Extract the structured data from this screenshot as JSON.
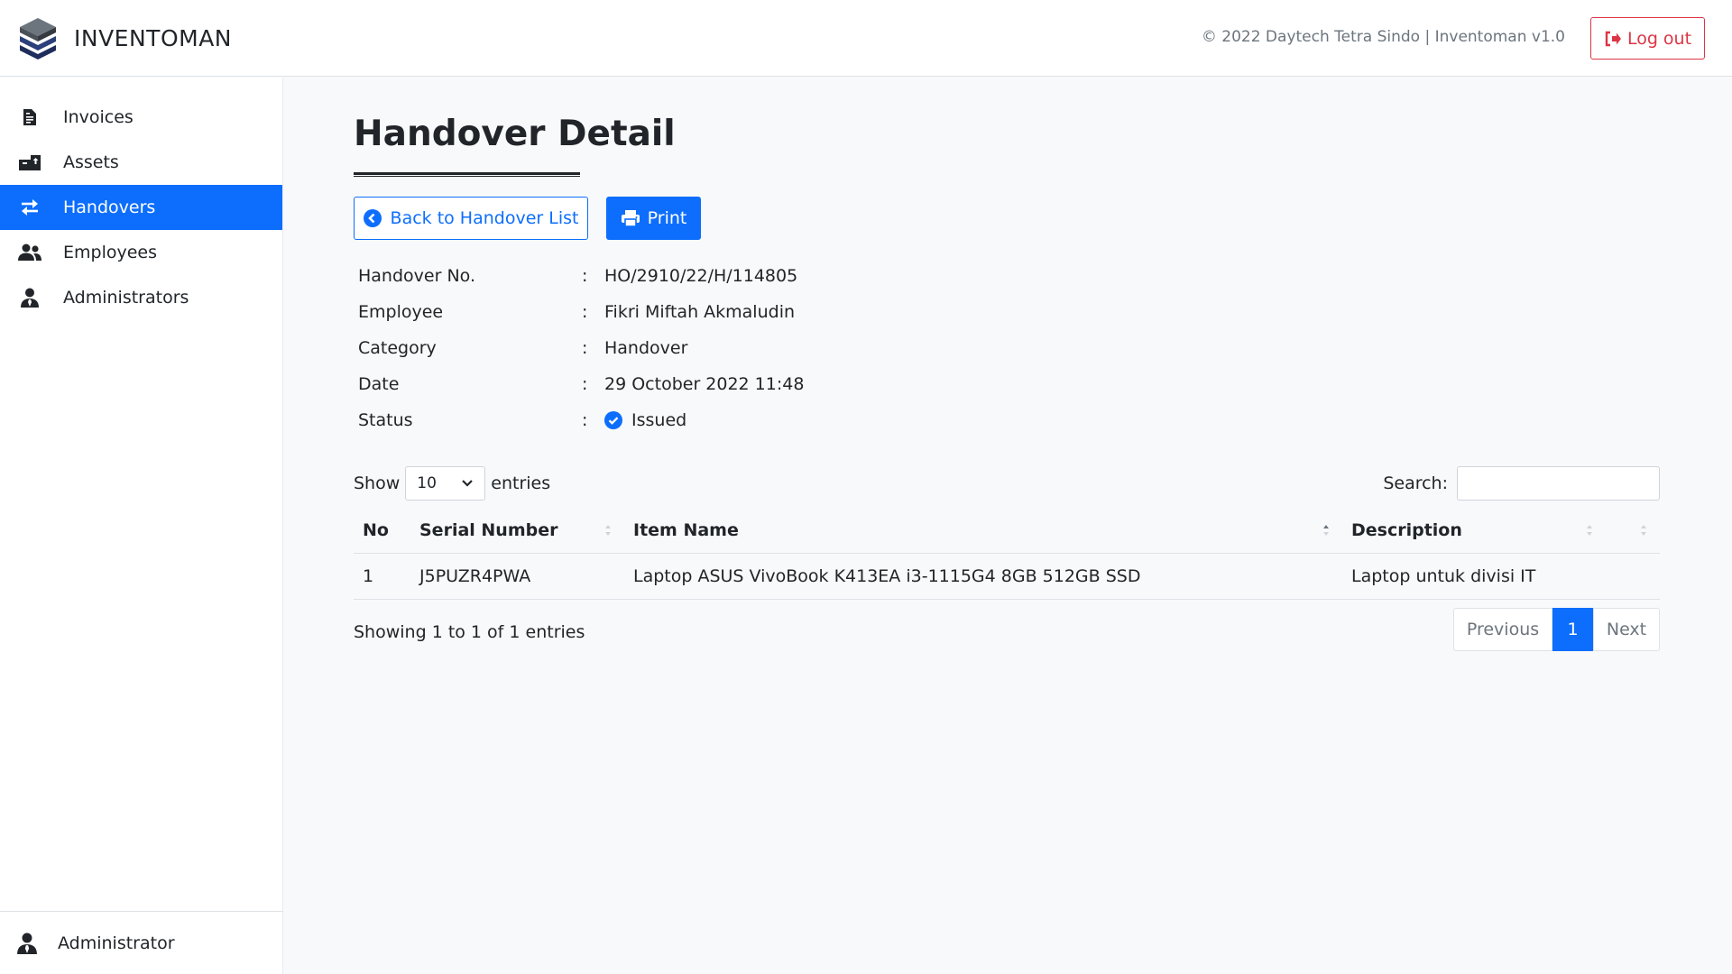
{
  "app": {
    "name": "INVENTOMAN",
    "copyright": "© 2022 Daytech Tetra Sindo | Inventoman v1.0",
    "logout_label": "Log out"
  },
  "sidebar": {
    "items": [
      {
        "label": "Invoices",
        "icon": "file-invoice-icon"
      },
      {
        "label": "Assets",
        "icon": "box-icon"
      },
      {
        "label": "Handovers",
        "icon": "exchange-icon",
        "active": true
      },
      {
        "label": "Employees",
        "icon": "users-icon"
      },
      {
        "label": "Administrators",
        "icon": "user-tie-icon"
      }
    ],
    "footer_user": "Administrator"
  },
  "page": {
    "title": "Handover Detail",
    "back_label": "Back to Handover List",
    "print_label": "Print"
  },
  "detail": {
    "rows": [
      {
        "label": "Handover No.",
        "value": "HO/2910/22/H/114805"
      },
      {
        "label": "Employee",
        "value": "Fikri Miftah Akmaludin"
      },
      {
        "label": "Category",
        "value": "Handover"
      },
      {
        "label": "Date",
        "value": "29 October 2022 11:48"
      },
      {
        "label": "Status",
        "value": "Issued"
      }
    ],
    "colon": ":"
  },
  "datatable": {
    "show_label": "Show",
    "entries_value": "10",
    "entries_label": "entries",
    "search_label": "Search:",
    "search_value": "",
    "columns": [
      "No",
      "Serial Number",
      "Item Name",
      "Description"
    ],
    "rows": [
      [
        "1",
        "J5PUZR4PWA",
        "Laptop ASUS VivoBook K413EA i3-1115G4 8GB 512GB SSD",
        "Laptop untuk divisi IT"
      ]
    ],
    "info": "Showing 1 to 1 of 1 entries",
    "pagination": {
      "previous": "Previous",
      "current": "1",
      "next": "Next"
    }
  },
  "colors": {
    "primary": "#0d6efd",
    "danger": "#dc3545",
    "muted": "#6c757d"
  }
}
